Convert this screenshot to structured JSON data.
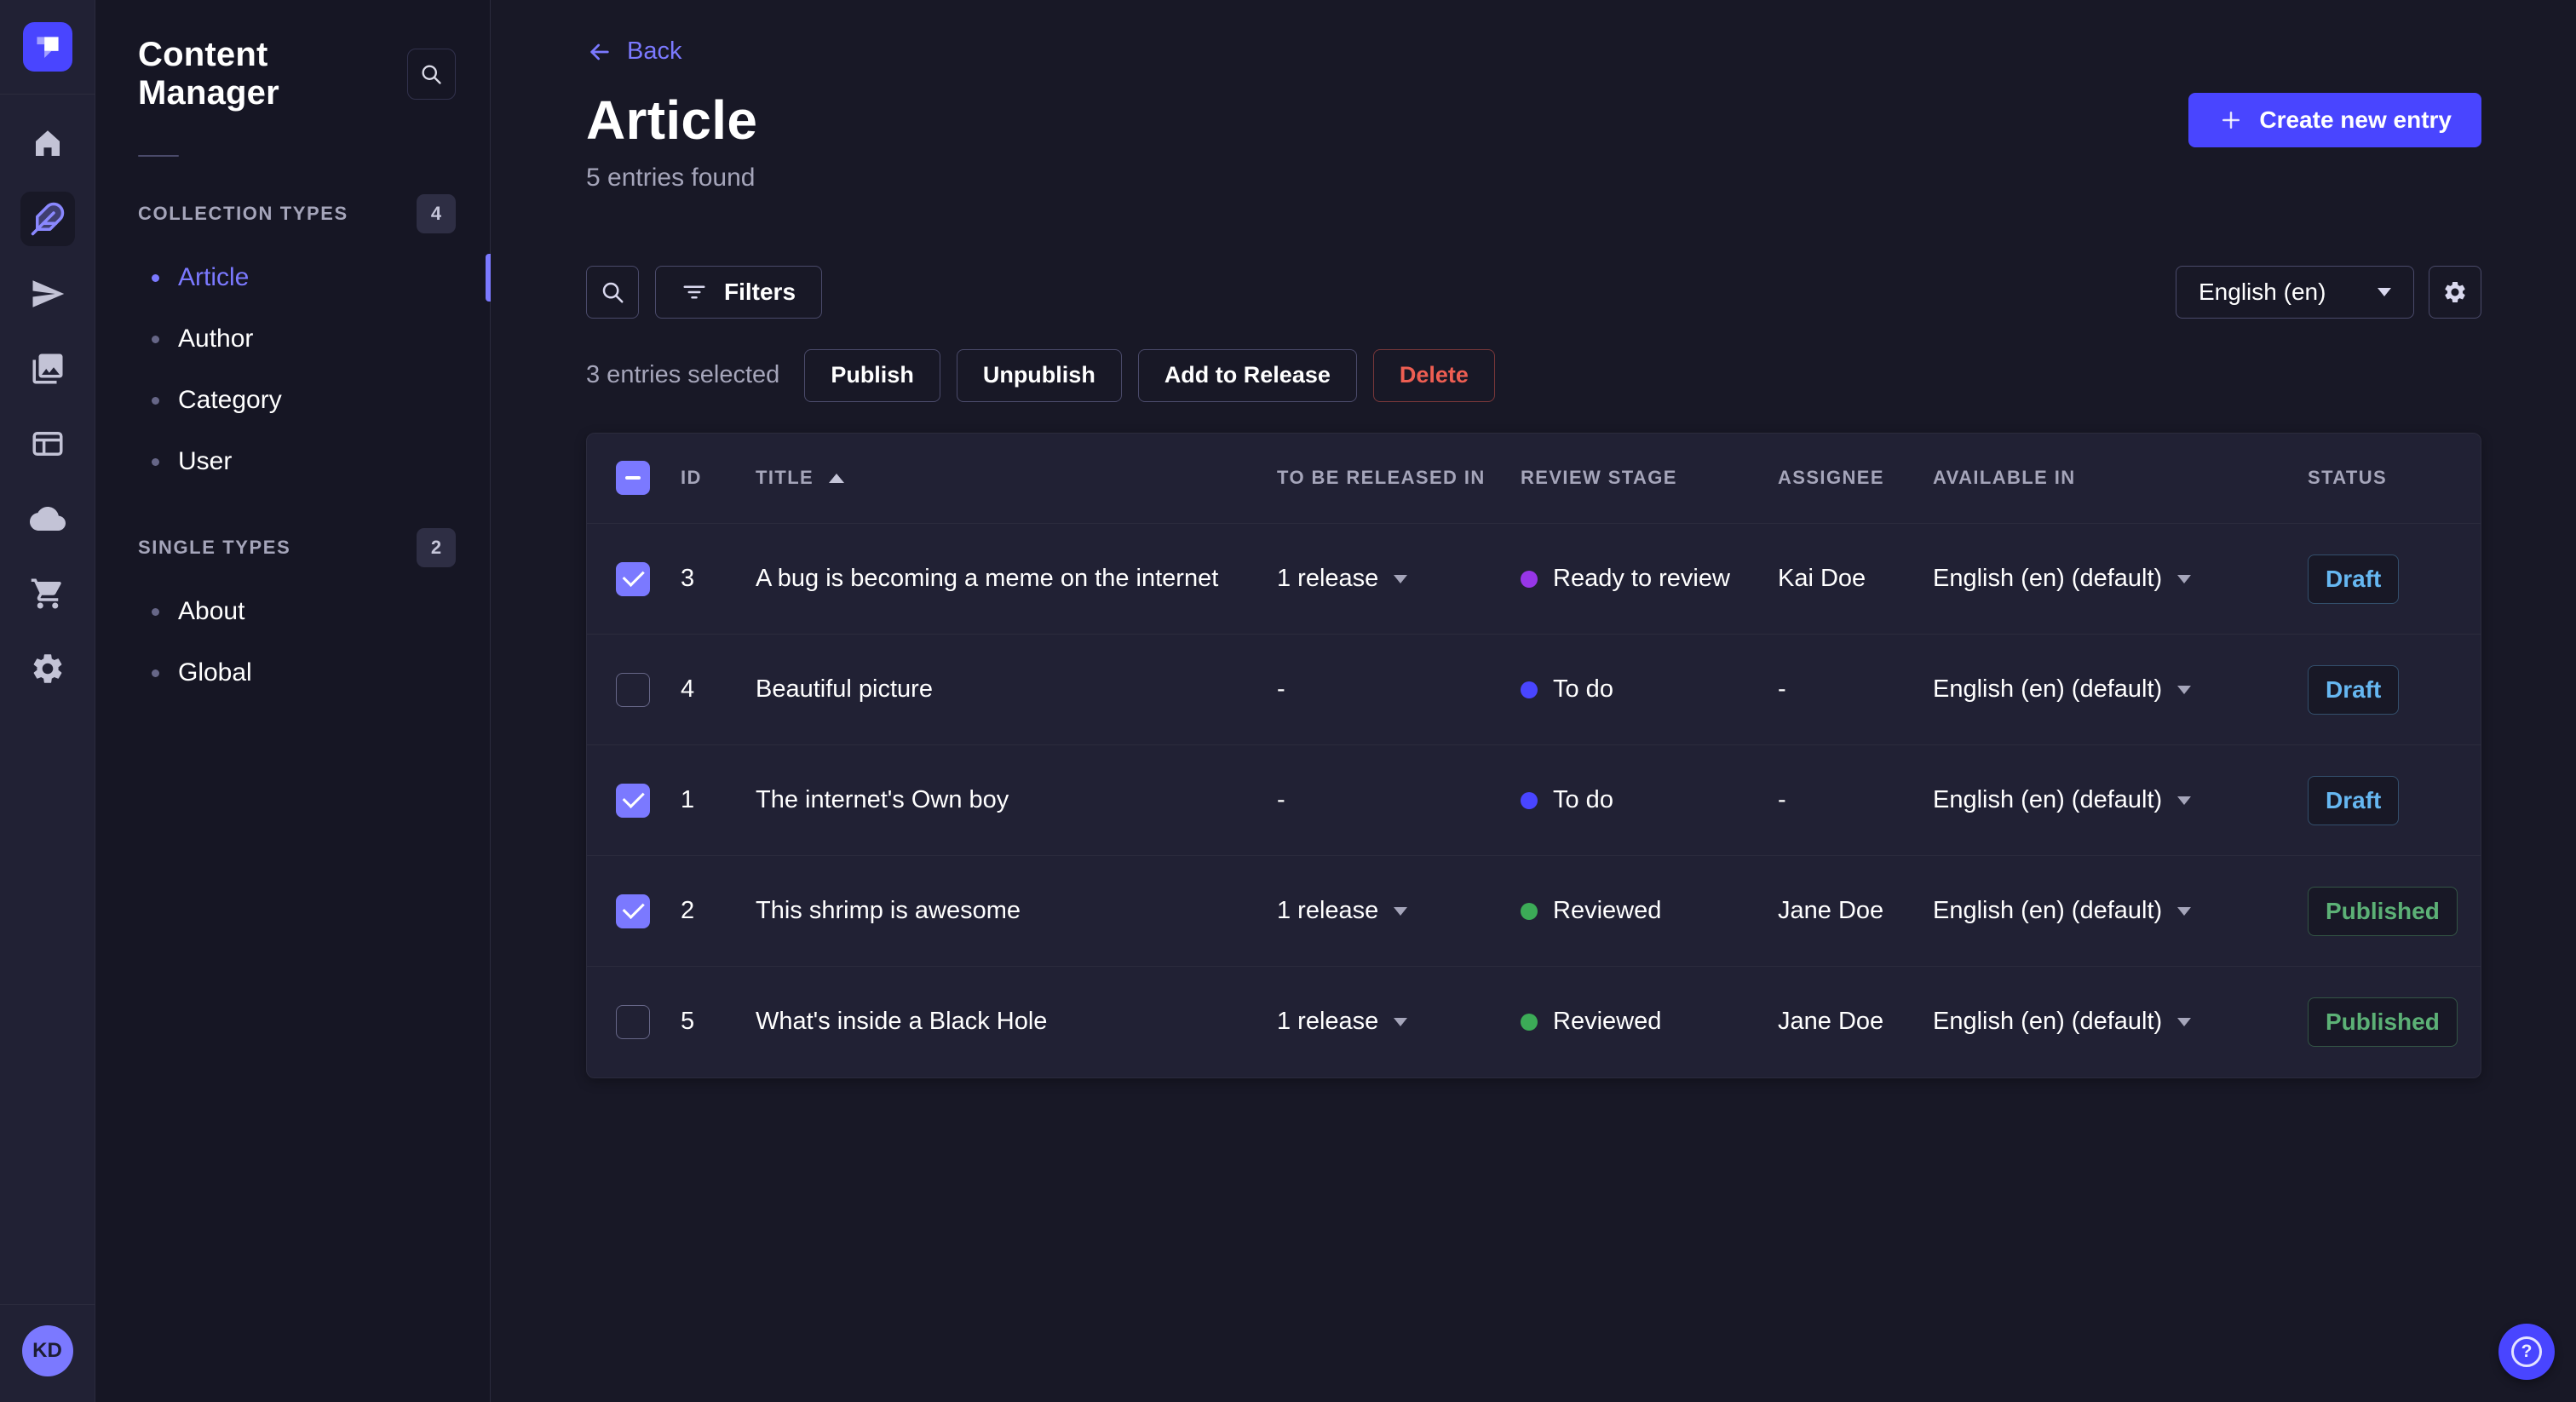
{
  "colors": {
    "primary": "#4945ff",
    "primary_light": "#7b79ff",
    "app_background": "#181826",
    "panel_background": "#212134",
    "subnav_background": "#161624",
    "border": "#2b2b3d",
    "text_secondary": "#a5a5ba",
    "draft": "#66b7f1",
    "published": "#5cb176",
    "danger": "#ee5e52",
    "stage_todo": "#4945ff",
    "stage_ready_to_review": "#9736e8",
    "stage_reviewed": "#3cab57"
  },
  "rail": {
    "logo_icon": "strapi-logo",
    "items": [
      {
        "icon": "home-icon",
        "active": false
      },
      {
        "icon": "feather-content-icon",
        "active": true
      },
      {
        "icon": "paper-plane-icon",
        "active": false
      },
      {
        "icon": "media-library-icon",
        "active": false
      },
      {
        "icon": "content-type-builder-icon",
        "active": false
      },
      {
        "icon": "cloud-icon",
        "active": false
      },
      {
        "icon": "cart-icon",
        "active": false
      },
      {
        "icon": "gear-icon",
        "active": false
      }
    ],
    "avatar_initials": "KD"
  },
  "subnav": {
    "title": "Content Manager",
    "search_icon": "search-icon",
    "sections": [
      {
        "label": "COLLECTION TYPES",
        "count": "4",
        "items": [
          {
            "label": "Article",
            "active": true
          },
          {
            "label": "Author",
            "active": false
          },
          {
            "label": "Category",
            "active": false
          },
          {
            "label": "User",
            "active": false
          }
        ]
      },
      {
        "label": "SINGLE TYPES",
        "count": "2",
        "items": [
          {
            "label": "About",
            "active": false
          },
          {
            "label": "Global",
            "active": false
          }
        ]
      }
    ]
  },
  "header": {
    "back": "Back",
    "title": "Article",
    "subtitle": "5 entries found",
    "create": "Create new entry"
  },
  "toolbar": {
    "filters": "Filters",
    "locale": "English (en)"
  },
  "selection": {
    "count_text": "3 entries selected",
    "publish": "Publish",
    "unpublish": "Unpublish",
    "add_to_release": "Add to Release",
    "delete": "Delete"
  },
  "table": {
    "header_checkbox_class": "checkbox indeterminate",
    "columns": [
      "ID",
      "TITLE",
      "TO BE RELEASED IN",
      "REVIEW STAGE",
      "ASSIGNEE",
      "AVAILABLE IN",
      "STATUS"
    ],
    "rows": [
      {
        "checkbox_class": "checkbox checked",
        "id": "3",
        "title": "A bug is becoming a meme on the internet",
        "release": "1 release",
        "stage": "Ready to review",
        "stage_style": "background:#9736e8",
        "assignee": "Kai Doe",
        "locale": "English (en) (default)",
        "status": "Draft",
        "status_class": "status-badge draft"
      },
      {
        "checkbox_class": "checkbox",
        "id": "4",
        "title": "Beautiful picture",
        "release": "-",
        "stage": "To do",
        "stage_style": "background:#4945ff",
        "assignee": "-",
        "locale": "English (en) (default)",
        "status": "Draft",
        "status_class": "status-badge draft"
      },
      {
        "checkbox_class": "checkbox checked",
        "id": "1",
        "title": "The internet's Own boy",
        "release": "-",
        "stage": "To do",
        "stage_style": "background:#4945ff",
        "assignee": "-",
        "locale": "English (en) (default)",
        "status": "Draft",
        "status_class": "status-badge draft"
      },
      {
        "checkbox_class": "checkbox checked",
        "id": "2",
        "title": "This shrimp is awesome",
        "release": "1 release",
        "stage": "Reviewed",
        "stage_style": "background:#3cab57",
        "assignee": "Jane Doe",
        "locale": "English (en) (default)",
        "status": "Published",
        "status_class": "status-badge published"
      },
      {
        "checkbox_class": "checkbox",
        "id": "5",
        "title": "What's inside a Black Hole",
        "release": "1 release",
        "stage": "Reviewed",
        "stage_style": "background:#3cab57",
        "assignee": "Jane Doe",
        "locale": "English (en) (default)",
        "status": "Published",
        "status_class": "status-badge published"
      }
    ]
  },
  "fab": {
    "help_glyph": "?"
  }
}
